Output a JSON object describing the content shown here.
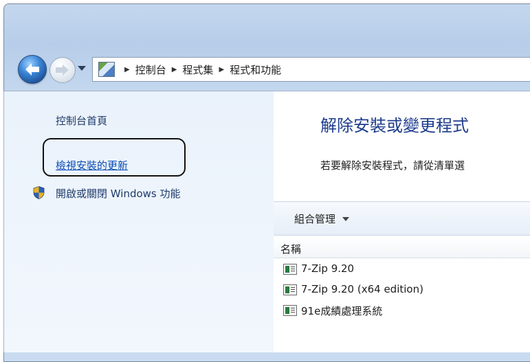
{
  "breadcrumb": [
    "控制台",
    "程式集",
    "程式和功能"
  ],
  "sidebar": {
    "home": "控制台首頁",
    "view_updates": "檢視安裝的更新",
    "windows_features": "開啟或關閉 Windows 功能"
  },
  "main": {
    "heading": "解除安裝或變更程式",
    "instructions": "若要解除安裝程式，請從清單選",
    "toolbar": {
      "organize": "組合管理"
    },
    "columns": {
      "name": "名稱"
    },
    "programs": [
      "7-Zip 9.20",
      "7-Zip 9.20 (x64 edition)",
      "91e成績處理系統"
    ]
  },
  "colors": {
    "link": "#0a4cb4",
    "heading": "#1e3c8c",
    "highlight_box": "#111111"
  }
}
